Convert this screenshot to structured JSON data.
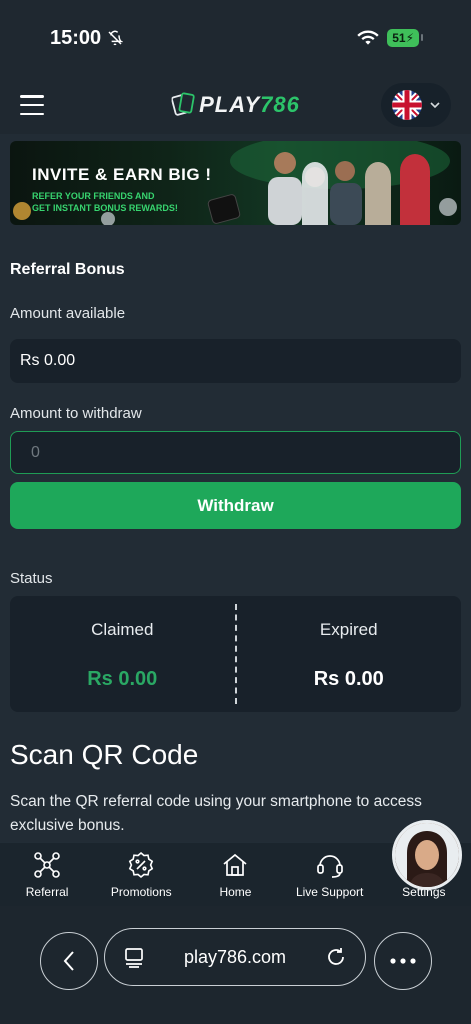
{
  "status_bar": {
    "time": "15:00",
    "battery": "51"
  },
  "header": {
    "logo_prefix": "PLAY",
    "logo_number": "786"
  },
  "banner": {
    "title": "INVITE & EARN BIG !",
    "subtitle_line1": "REFER YOUR FRIENDS AND",
    "subtitle_line2": "GET INSTANT BONUS REWARDS!"
  },
  "referral": {
    "section_title": "Referral Bonus",
    "amount_available_label": "Amount available",
    "amount_available_value": "Rs 0.00",
    "amount_withdraw_label": "Amount to withdraw",
    "amount_withdraw_placeholder": "0",
    "withdraw_button": "Withdraw"
  },
  "status": {
    "label": "Status",
    "claimed_label": "Claimed",
    "claimed_value": "Rs 0.00",
    "expired_label": "Expired",
    "expired_value": "Rs 0.00"
  },
  "scan": {
    "title": "Scan QR Code",
    "description": "Scan the QR referral code using your smartphone to access exclusive bonus."
  },
  "bottom_nav": {
    "items": [
      {
        "label": "Referral",
        "icon": "referral-icon"
      },
      {
        "label": "Promotions",
        "icon": "promotions-icon"
      },
      {
        "label": "Home",
        "icon": "home-icon"
      },
      {
        "label": "Live Support",
        "icon": "headset-icon"
      },
      {
        "label": "Settings",
        "icon": "settings-icon"
      }
    ]
  },
  "browser": {
    "url": "play786.com"
  },
  "colors": {
    "accent_green": "#1ea85a",
    "claimed_green": "#2aa864",
    "background": "#1f2830"
  }
}
